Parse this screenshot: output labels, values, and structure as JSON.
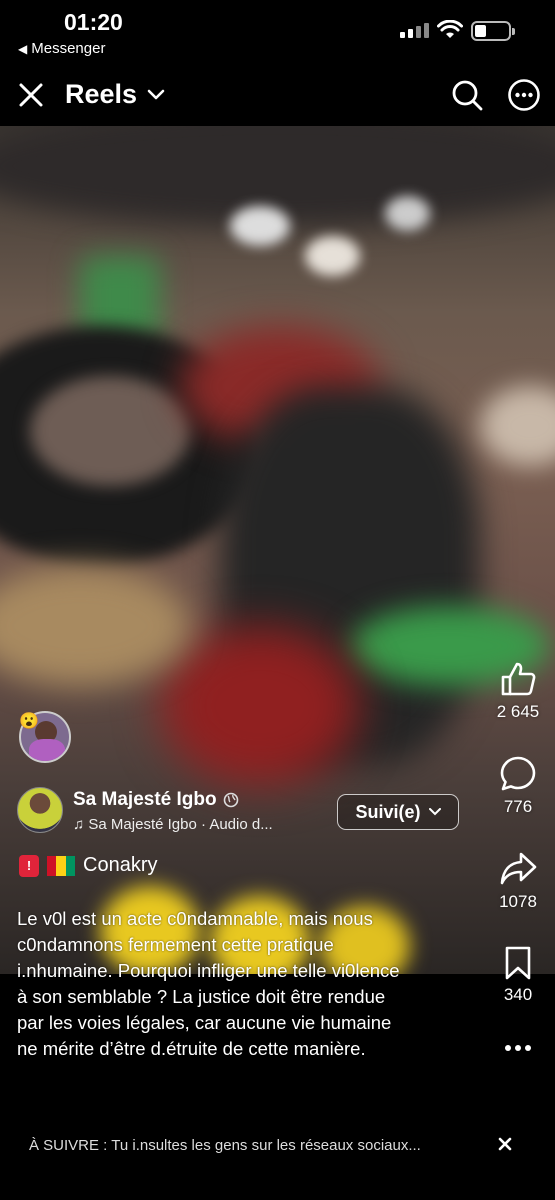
{
  "status_bar": {
    "time": "01:20",
    "back_app": "Messenger"
  },
  "header": {
    "title": "Reels"
  },
  "actions": {
    "likes": "2 645",
    "comments": "776",
    "shares": "1078",
    "saves": "340"
  },
  "reel": {
    "reaction_emoji": "😮",
    "author": "Sa Majesté Igbo",
    "audio": "Sa Majesté Igbo · Audio d...",
    "follow_label": "Suivi(e)",
    "location": "Conakry",
    "caption_lines": [
      "Le v0l est un acte c0ndamnable, mais nous",
      "c0ndamnons fermement cette pratique",
      "i.nhumaine. Pourquoi infliger une telle vi0lence",
      "à son semblable ? La justice doit être rendue",
      "par les voies légales, car aucune vie humaine",
      "ne mérite d’être d.étruite de cette manière."
    ]
  },
  "next_up": {
    "text": "À SUIVRE : Tu i.nsultes les gens sur les réseaux sociaux..."
  },
  "colors": {
    "background": "#000000",
    "text": "#ffffff",
    "flag_red": "#ce1126",
    "flag_yellow": "#fcd116",
    "flag_green": "#009460",
    "badge_red": "#e0243a"
  }
}
